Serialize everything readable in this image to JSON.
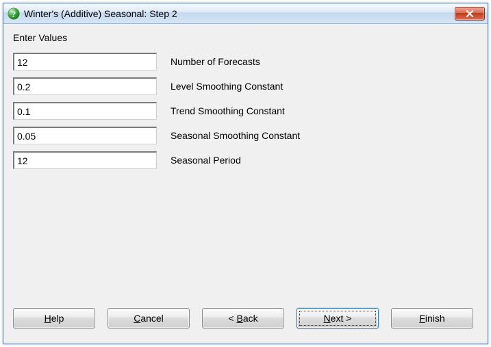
{
  "window": {
    "title": "Winter's (Additive) Seasonal: Step 2"
  },
  "section_label": "Enter Values",
  "fields": {
    "forecasts": {
      "value": "12",
      "label": "Number of Forecasts"
    },
    "level": {
      "value": "0.2",
      "label": "Level Smoothing Constant"
    },
    "trend": {
      "value": "0.1",
      "label": "Trend Smoothing Constant"
    },
    "seasonal_const": {
      "value": "0.05",
      "label": "Seasonal Smoothing Constant"
    },
    "seasonal_period": {
      "value": "12",
      "label": "Seasonal Period"
    }
  },
  "buttons": {
    "help": "Help",
    "cancel": "Cancel",
    "back": "Back",
    "next": "Next",
    "finish": "Finish",
    "lt": "<",
    "gt": ">"
  }
}
